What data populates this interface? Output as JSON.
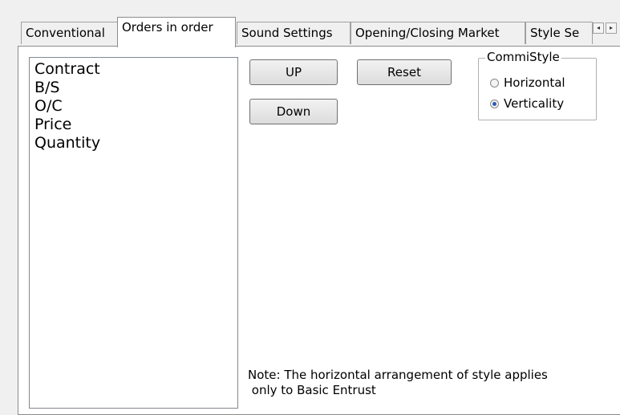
{
  "tabs": [
    {
      "label": "Conventional",
      "selected": false
    },
    {
      "label": "Orders in order",
      "selected": true
    },
    {
      "label": "Sound Settings",
      "selected": false
    },
    {
      "label": "Opening/Closing Market",
      "selected": false
    },
    {
      "label": "Style Se",
      "selected": false
    }
  ],
  "tab_scroll": {
    "left_glyph": "◂",
    "right_glyph": "▸"
  },
  "column_list": {
    "items": [
      "Contract",
      "B/S",
      "O/C",
      "Price",
      "Quantity"
    ]
  },
  "buttons": {
    "up_label": "UP",
    "down_label": "Down",
    "reset_label": "Reset"
  },
  "commi_style": {
    "legend": "CommiStyle",
    "options": [
      {
        "label": "Horizontal",
        "checked": false
      },
      {
        "label": "Verticality",
        "checked": true
      }
    ]
  },
  "note": {
    "line1": "Note: The horizontal arrangement of style applies",
    "line2": " only to Basic Entrust"
  }
}
